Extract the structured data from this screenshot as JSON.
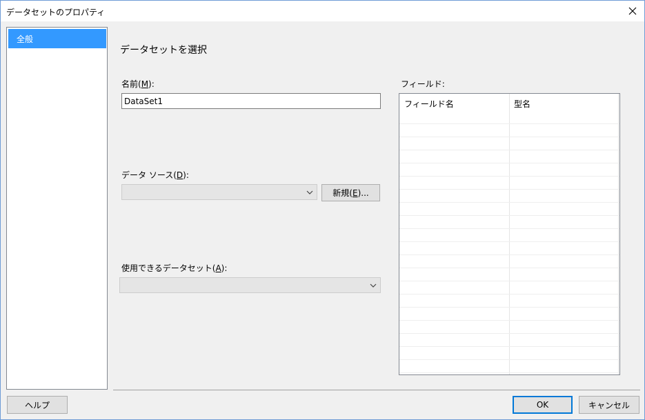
{
  "window": {
    "title": "データセットのプロパティ"
  },
  "nav": {
    "items": [
      {
        "label": "全般",
        "selected": true
      }
    ]
  },
  "main": {
    "section_title": "データセットを選択",
    "name_label_pre": "名前(",
    "name_label_key": "M",
    "name_label_post": "):",
    "name_value": "DataSet1",
    "datasource_label_pre": "データ ソース(",
    "datasource_label_key": "D",
    "datasource_label_post": "):",
    "datasource_value": "",
    "new_button_pre": "新規(",
    "new_button_key": "E",
    "new_button_post": ")...",
    "available_label_pre": "使用できるデータセット(",
    "available_label_key": "A",
    "available_label_post": "):",
    "available_value": ""
  },
  "fields": {
    "label": "フィールド:",
    "columns": [
      "フィールド名",
      "型名"
    ],
    "rows": []
  },
  "footer": {
    "help_label": "ヘルプ",
    "ok_label": "OK",
    "cancel_label": "キャンセル"
  },
  "colors": {
    "accent": "#0078d7",
    "selection": "#3399ff"
  }
}
